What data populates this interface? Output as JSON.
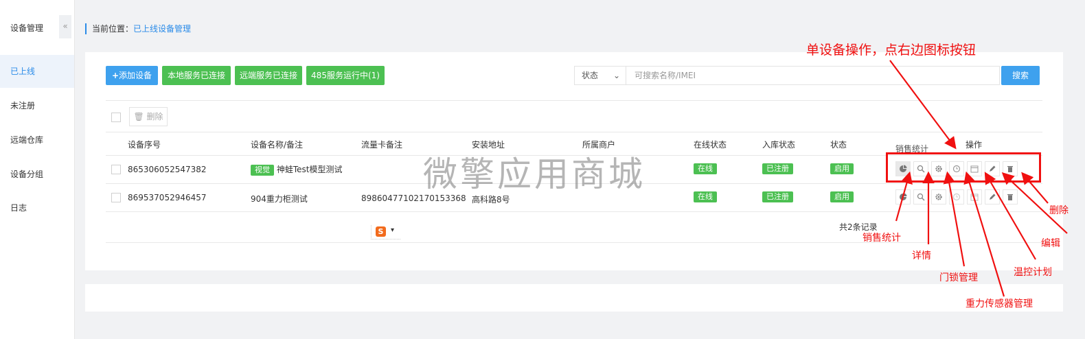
{
  "sidebar": {
    "title": "设备管理",
    "collapse_icon": "«",
    "items": [
      {
        "label": "已上线",
        "active": true
      },
      {
        "label": "未注册",
        "active": false
      },
      {
        "label": "远端仓库",
        "active": false
      },
      {
        "label": "设备分组",
        "active": false
      },
      {
        "label": "日志",
        "active": false
      }
    ]
  },
  "breadcrumb": {
    "prefix": "当前位置：",
    "current": "已上线设备管理"
  },
  "toolbar": {
    "add_label": "添加设备",
    "local_label": "本地服务已连接",
    "remote_label": "远端服务已连接",
    "service485_label": "485服务运行中(1)",
    "status_select": "状态",
    "search_placeholder": "可搜索名称/IMEI",
    "search_label": "搜索",
    "delete_label": "删除"
  },
  "table": {
    "columns": [
      "设备序号",
      "设备名称/备注",
      "流量卡备注",
      "安装地址",
      "所属商户",
      "在线状态",
      "入库状态",
      "状态",
      "销售统计",
      "操作"
    ],
    "rows": [
      {
        "serial": "865306052547382",
        "tag": "视觉",
        "name": "神蛙Test模型测试",
        "card": "",
        "address": "",
        "merchant": "",
        "online": "在线",
        "stock": "已注册",
        "status": "启用"
      },
      {
        "serial": "869537052946457",
        "tag": "",
        "name": "904重力柜测试",
        "card": "89860477102170153368",
        "address": "高科路8号",
        "merchant": "",
        "online": "在线",
        "stock": "已注册",
        "status": "启用"
      }
    ],
    "total": "共2条记录"
  },
  "ops_icons": [
    "pie-chart-icon",
    "search-detail-icon",
    "gear-icon",
    "clock-icon",
    "calendar-icon",
    "pencil-icon",
    "trash-icon"
  ],
  "watermark": "微擎应用商城",
  "annotations": {
    "headline": "单设备操作，点右边图标按钮",
    "sales": "销售统计",
    "detail": "详情",
    "lock": "门锁管理",
    "sensor": "重力传感器管理",
    "temp": "温控计划",
    "edit": "编辑",
    "delete": "删除"
  },
  "ime": {
    "logo": "S"
  },
  "colors": {
    "accent": "#2a8be8",
    "green": "#4cc052",
    "annotation_red": "#f01010"
  }
}
